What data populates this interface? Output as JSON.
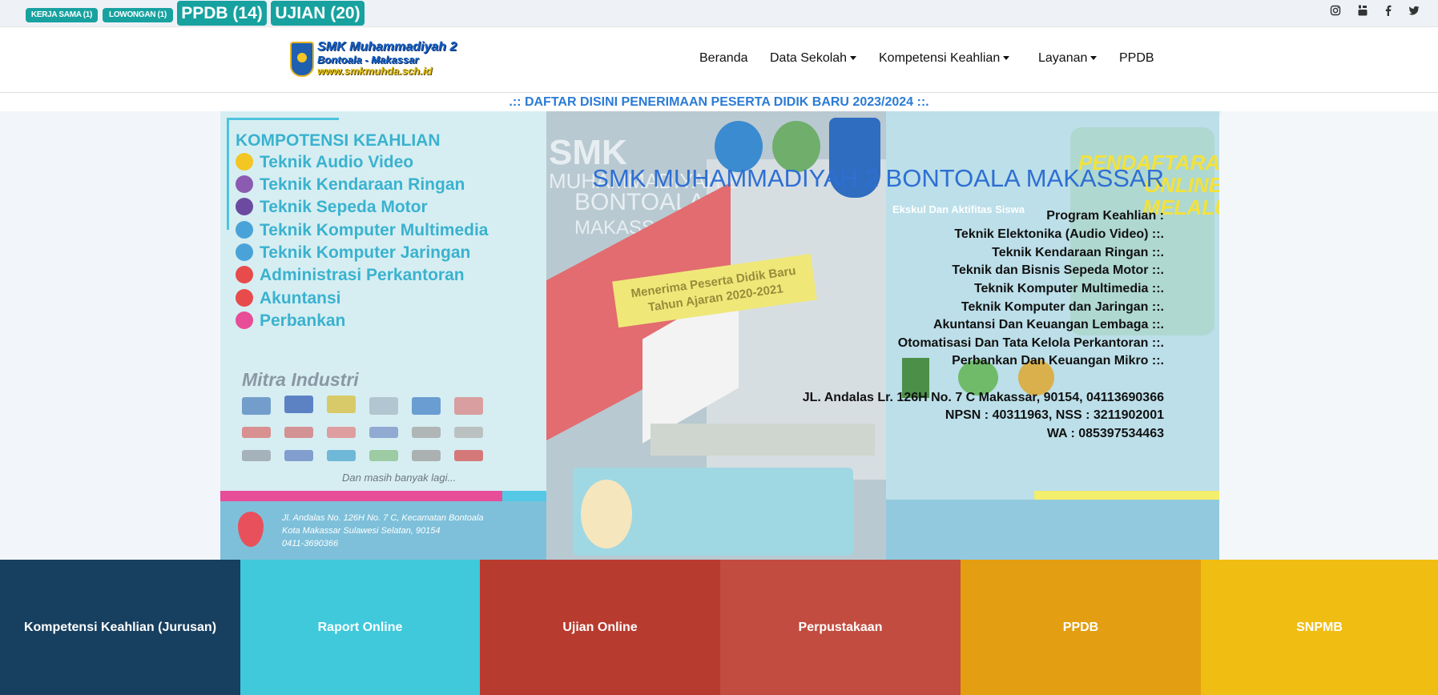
{
  "topbar": {
    "pills": [
      {
        "label": "KERJA SAMA (1)"
      },
      {
        "label": "LOWONGAN (1)"
      },
      {
        "label": "PPDB (14)"
      },
      {
        "label": "UJIAN (20)"
      }
    ],
    "social_icons": [
      "instagram-icon",
      "youtube-icon",
      "facebook-icon",
      "twitter-icon"
    ]
  },
  "logo": {
    "line1": "SMK Muhammadiyah 2",
    "line2": "Bontoala - Makassar",
    "line3": "www.smkmuhda.sch.id"
  },
  "nav": {
    "items": [
      {
        "label": "Beranda",
        "dropdown": false
      },
      {
        "label": "Data Sekolah",
        "dropdown": true
      },
      {
        "label": "Kompetensi Keahlian",
        "dropdown": true
      },
      {
        "label": "Layanan",
        "dropdown": true
      },
      {
        "label": "PPDB",
        "dropdown": false
      }
    ]
  },
  "marquee": ".:: DAFTAR DISINI PENERIMAAN PESERTA DIDIK BARU 2023/2024 ::.",
  "banner": {
    "left": {
      "title": "KOMPOTENSI KEAHLIAN",
      "items": [
        "Teknik Audio Video",
        "Teknik Kendaraan Ringan",
        "Teknik Sepeda Motor",
        "Teknik Komputer Multimedia",
        "Teknik Komputer Jaringan",
        "Administrasi Perkantoran",
        "Akuntansi",
        "Perbankan"
      ],
      "mitra_title": "Mitra Industri",
      "more_text": "Dan masih banyak lagi...",
      "address_lines": [
        "Jl. Andalas No. 126H No. 7 C, Kecamatan Bontoala",
        "Kota Makassar Sulawesi Selatan, 90154",
        "0411-3690366"
      ]
    },
    "middle": {
      "smk": "SMK",
      "sub1": "MUHAMMADIYAH 2",
      "sub2": "BONTOALA",
      "sub3": "MAKASSAR",
      "banner_text1": "Menerima Peserta Didik Baru",
      "banner_text2": "Tahun Ajaran 2020-2021"
    },
    "right": {
      "title1": "PENDAFTARAN",
      "title2": "ONLINE - MELALUI",
      "ekskul": "Ekskul Dan Aktifitas Siswa"
    },
    "colors": {
      "left_item_dots": [
        "#f3c623",
        "#8a5bb0",
        "#6b4aa0",
        "#4aa3d8",
        "#4aa3d8",
        "#e84b4b",
        "#e84b4b",
        "#e84d98"
      ]
    }
  },
  "hero": {
    "title": "SMK MUHAMMADIYAH 2 BONTOALA MAKASSAR",
    "lines": [
      "Program Keahlian :",
      "Teknik Elektonika (Audio Video) ::.",
      "Teknik Kendaraan Ringan ::.",
      "Teknik dan Bisnis Sepeda Motor ::.",
      "Teknik Komputer Multimedia ::.",
      "Teknik Komputer dan Jaringan ::.",
      "Akuntansi Dan Keuangan Lembaga ::.",
      "Otomatisasi Dan Tata Kelola Perkantoran ::.",
      "Perbankan Dan Keuangan Mikro ::.",
      "",
      "JL. Andalas Lr. 126H No. 7 C Makassar, 90154, 04113690366",
      "NPSN : 40311963, NSS : 3211902001",
      "WA : 085397534463"
    ]
  },
  "tiles": [
    {
      "label": "Kompetensi Keahlian (Jurusan)",
      "color": "#173f5f"
    },
    {
      "label": "Raport Online",
      "color": "#3fc9db"
    },
    {
      "label": "Ujian Online",
      "color": "#b83b2f"
    },
    {
      "label": "Perpustakaan",
      "color": "#c14c3f"
    },
    {
      "label": "PPDB",
      "color": "#e39e12"
    },
    {
      "label": "SNPMB",
      "color": "#f0bd12"
    }
  ]
}
